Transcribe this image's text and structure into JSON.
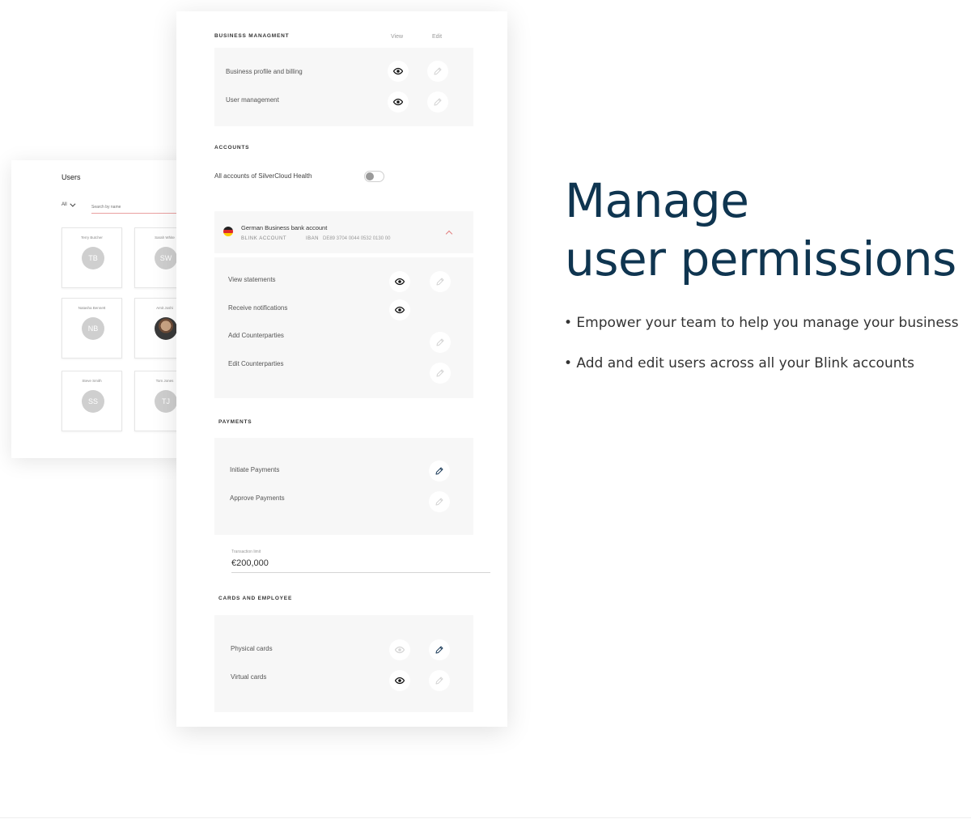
{
  "users_panel": {
    "title": "Users",
    "filter_label": "All",
    "search_placeholder": "Search by name",
    "users": [
      {
        "name": "Terry Butcher",
        "initials": "TB",
        "photo": false
      },
      {
        "name": "Sarah White",
        "initials": "SW",
        "photo": false
      },
      {
        "name": "Natasha Bennett",
        "initials": "NB",
        "photo": false
      },
      {
        "name": "Amit Joshi",
        "initials": "",
        "photo": true
      },
      {
        "name": "Steve Smith",
        "initials": "SS",
        "photo": false
      },
      {
        "name": "Tom Jones",
        "initials": "TJ",
        "photo": false
      }
    ]
  },
  "permissions": {
    "view_header": "View",
    "edit_header": "Edit",
    "business_management": {
      "title": "BUSINESS MANAGMENT",
      "rows": [
        {
          "label": "Business profile and billing",
          "view": "active",
          "edit": "disabled"
        },
        {
          "label": "User management",
          "view": "active",
          "edit": "disabled"
        }
      ]
    },
    "accounts": {
      "title": "ACCOUNTS",
      "all_accounts_label": "All accounts of SilverCloud Health",
      "toggle_on": false,
      "bank_account": {
        "name": "German Business bank account",
        "type": "BLINK ACCOUNT",
        "iban_label": "IBAN",
        "iban": "DE89 3704 0044 0532 0130 00",
        "expanded": true
      },
      "rows": [
        {
          "label": "View statements",
          "view": "active",
          "edit": "disabled"
        },
        {
          "label": "Receive notifications",
          "view": "active",
          "edit": "none"
        },
        {
          "label": "Add Counterparties",
          "view": "none",
          "edit": "disabled"
        },
        {
          "label": "Edit Counterparties",
          "view": "none",
          "edit": "disabled"
        }
      ]
    },
    "payments": {
      "title": "PAYMENTS",
      "rows": [
        {
          "label": "Initiate Payments",
          "view": "none",
          "edit": "active"
        },
        {
          "label": "Approve Payments",
          "view": "none",
          "edit": "disabled"
        }
      ],
      "limit_label": "Transaction limit",
      "limit_value": "€200,000"
    },
    "cards": {
      "title": "CARDS AND EMPLOYEE",
      "rows": [
        {
          "label": "Physical cards",
          "view": "disabled",
          "edit": "active"
        },
        {
          "label": "Virtual cards",
          "view": "active",
          "edit": "disabled"
        }
      ]
    }
  },
  "marketing": {
    "headline_line1": "Manage",
    "headline_line2": "user permissions",
    "bullet1": "• Empower your team to help you manage your business",
    "bullet2": "• Add and edit users across all your Blink accounts"
  },
  "colors": {
    "headline": "#0f3550",
    "active_icon": "#111111",
    "disabled_icon": "#d4d4d4",
    "edit_active_icon": "#1d3c5a",
    "accent_red": "#e38080"
  }
}
